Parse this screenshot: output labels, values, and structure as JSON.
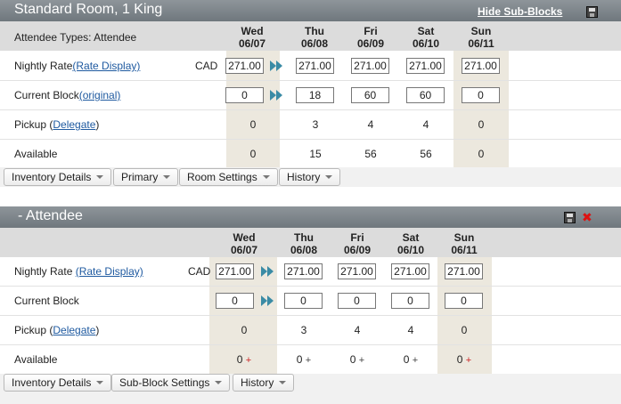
{
  "block1": {
    "title": "Standard Room, 1 King",
    "hide_link": "Hide Sub-Blocks",
    "attendee_types": "Attendee Types: Attendee",
    "days": [
      {
        "dow": "Wed",
        "date": "06/07"
      },
      {
        "dow": "Thu",
        "date": "06/08"
      },
      {
        "dow": "Fri",
        "date": "06/09"
      },
      {
        "dow": "Sat",
        "date": "06/10"
      },
      {
        "dow": "Sun",
        "date": "06/11"
      }
    ],
    "nightly_rate_label": "Nightly Rate",
    "rate_display_link": "(Rate Display)",
    "currency": "CAD",
    "rates": [
      "271.00",
      "271.00",
      "271.00",
      "271.00",
      "271.00"
    ],
    "current_block_label": "Current Block",
    "original_link": "(original)",
    "blocks": [
      "0",
      "18",
      "60",
      "60",
      "0"
    ],
    "pickup_label": "Pickup (",
    "pickup_link": "Delegate",
    "pickup_close": ")",
    "pickup": [
      "0",
      "3",
      "4",
      "4",
      "0"
    ],
    "available_label": "Available",
    "available": [
      "0",
      "15",
      "56",
      "56",
      "0"
    ],
    "toolbar": [
      "Inventory Details",
      "Primary",
      "Room Settings",
      "History"
    ]
  },
  "block2": {
    "title": "- Attendee",
    "days": [
      {
        "dow": "Wed",
        "date": "06/07"
      },
      {
        "dow": "Thu",
        "date": "06/08"
      },
      {
        "dow": "Fri",
        "date": "06/09"
      },
      {
        "dow": "Sat",
        "date": "06/10"
      },
      {
        "dow": "Sun",
        "date": "06/11"
      }
    ],
    "nightly_rate_label": "Nightly Rate",
    "rate_display_link": "(Rate Display)",
    "currency": "CAD",
    "rates": [
      "271.00",
      "271.00",
      "271.00",
      "271.00",
      "271.00"
    ],
    "current_block_label": "Current Block",
    "blocks": [
      "0",
      "0",
      "0",
      "0",
      "0"
    ],
    "pickup_label": "Pickup (",
    "pickup_link": "Delegate",
    "pickup_close": ")",
    "pickup": [
      "0",
      "3",
      "4",
      "4",
      "0"
    ],
    "available_label": "Available",
    "available": [
      "0",
      "0",
      "0",
      "0",
      "0"
    ],
    "plus": "+",
    "toolbar": [
      "Inventory Details",
      "Sub-Block Settings",
      "History"
    ]
  },
  "colors": {
    "header_gradient_top": "#8e959a",
    "header_gradient_bottom": "#6f777d",
    "weekend_shade": "#ece8de",
    "link": "#1f5aa0",
    "fast_forward": "#3a8ba5",
    "delete_red": "#d11111"
  }
}
